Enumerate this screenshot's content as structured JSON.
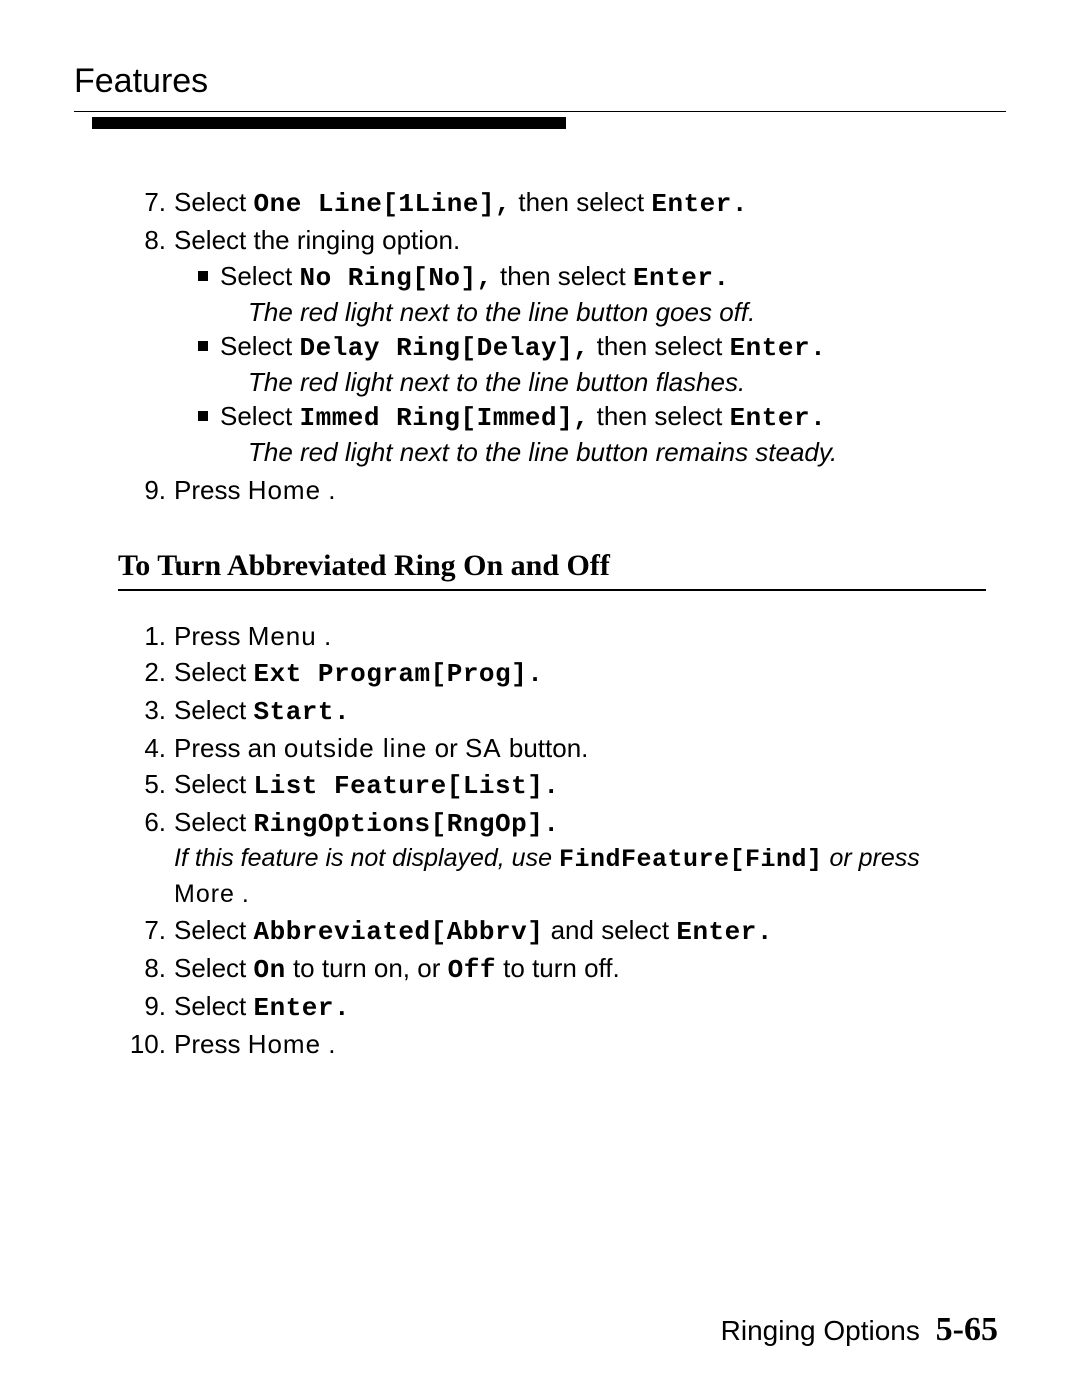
{
  "header": {
    "title": "Features"
  },
  "listA": {
    "items": [
      {
        "n": "7.",
        "pre": "Select ",
        "mono1": "One Line[1Line],",
        "mid": " then select ",
        "mono2": "Enter."
      },
      {
        "n": "8.",
        "text": "Select the ringing option.",
        "bullets": [
          {
            "pre": "Select ",
            "mono1": "No Ring[No],",
            "mid": " then select ",
            "mono2": "Enter.",
            "result": "The red light next to the line button goes off."
          },
          {
            "pre": "Select ",
            "mono1": "Delay Ring[Delay],",
            "mid": " then select ",
            "mono2": "Enter.",
            "result": "The red light next to the line button flashes."
          },
          {
            "pre": "Select ",
            "mono1": "Immed Ring[Immed],",
            "mid": " then select ",
            "mono2": "Enter.",
            "result": "The red light next to the line button remains steady."
          }
        ]
      },
      {
        "n": "9.",
        "pre": "Press ",
        "key": "Home",
        "post": "."
      }
    ]
  },
  "section": {
    "title": "To Turn Abbreviated Ring On and Off"
  },
  "listB": {
    "items": [
      {
        "n": "1.",
        "pre": "Press ",
        "key": "Menu",
        "post": "."
      },
      {
        "n": "2.",
        "pre": "Select ",
        "mono1": "Ext Program[Prog]."
      },
      {
        "n": "3.",
        "pre": "Select ",
        "mono1": "Start."
      },
      {
        "n": "4.",
        "pre": "Press an ",
        "key": "outside line",
        "mid": " or ",
        "key2": "SA",
        "post": " button."
      },
      {
        "n": "5.",
        "pre": "Select ",
        "mono1": "List Feature[List]."
      },
      {
        "n": "6.",
        "pre": "Select ",
        "mono1": "RingOptions[RngOp].",
        "sub": {
          "pre": "If this feature is not displayed, use ",
          "mono": "FindFeature[Find]",
          "mid": " or press ",
          "key": "More",
          "post": "."
        }
      },
      {
        "n": "7.",
        "pre": "Select ",
        "mono1": "Abbreviated[Abbrv]",
        "mid": " and select ",
        "mono2": "Enter."
      },
      {
        "n": "8.",
        "pre": "Select ",
        "mono1": "On",
        "mid": " to turn on, or ",
        "mono2": "Off",
        "post": " to turn off."
      },
      {
        "n": "9.",
        "pre": "Select ",
        "mono1": "Enter."
      },
      {
        "n": "10.",
        "pre": "Press ",
        "key": "Home",
        "post": "."
      }
    ]
  },
  "footer": {
    "label": "Ringing Options",
    "page": "5-65"
  }
}
